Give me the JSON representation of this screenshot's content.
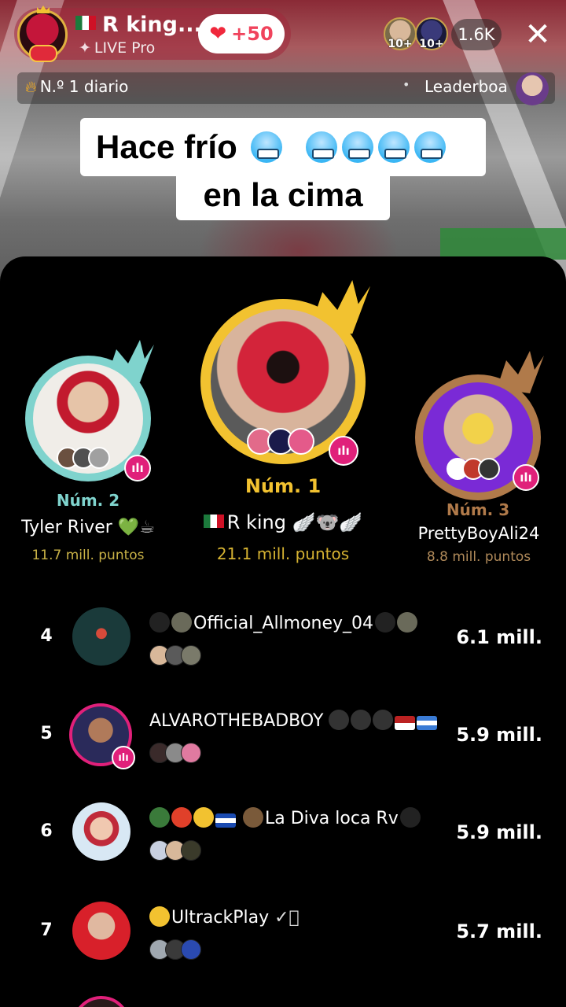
{
  "host": {
    "name": "R king...",
    "subtitle": "LIVE Pro",
    "likes": "+50"
  },
  "viewers": {
    "badge_1": "10+",
    "badge_2": "10+",
    "count": "1.6K"
  },
  "rank_strip": {
    "daily": "N.º 1 diario",
    "leaderboard": "Leaderboa"
  },
  "caption": {
    "line1": "Hace frío",
    "line2": "en la cima"
  },
  "podium": [
    {
      "label": "Núm. 2",
      "name": "Tyler River",
      "points": "11.7 mill. puntos",
      "color": "#7fd3cd"
    },
    {
      "label": "Núm. 1",
      "name": "R king",
      "points": "21.1 mill. puntos",
      "color": "#f2c230"
    },
    {
      "label": "Núm. 3",
      "name": "PrettyBoyAli24",
      "points": "8.8 mill. puntos",
      "color": "#b07a4a"
    }
  ],
  "list": [
    {
      "rank": "4",
      "name": "Official_Allmoney_04",
      "score": "6.1 mill."
    },
    {
      "rank": "5",
      "name": "ALVAROTHEBADBOY",
      "score": "5.9 mill."
    },
    {
      "rank": "6",
      "name": "La Diva loca Rv",
      "score": "5.9 mill."
    },
    {
      "rank": "7",
      "name": "UltrackPlay",
      "score": "5.7 mill."
    }
  ],
  "icons": {
    "close": "close-icon",
    "heart": "heart-icon",
    "fire": "fire-icon",
    "bars": "stats-bars-icon"
  },
  "colors": {
    "pink_badge": "#e0207a",
    "gold": "#f2c230",
    "teal": "#7fd3cd",
    "bronze": "#b07a4a"
  }
}
